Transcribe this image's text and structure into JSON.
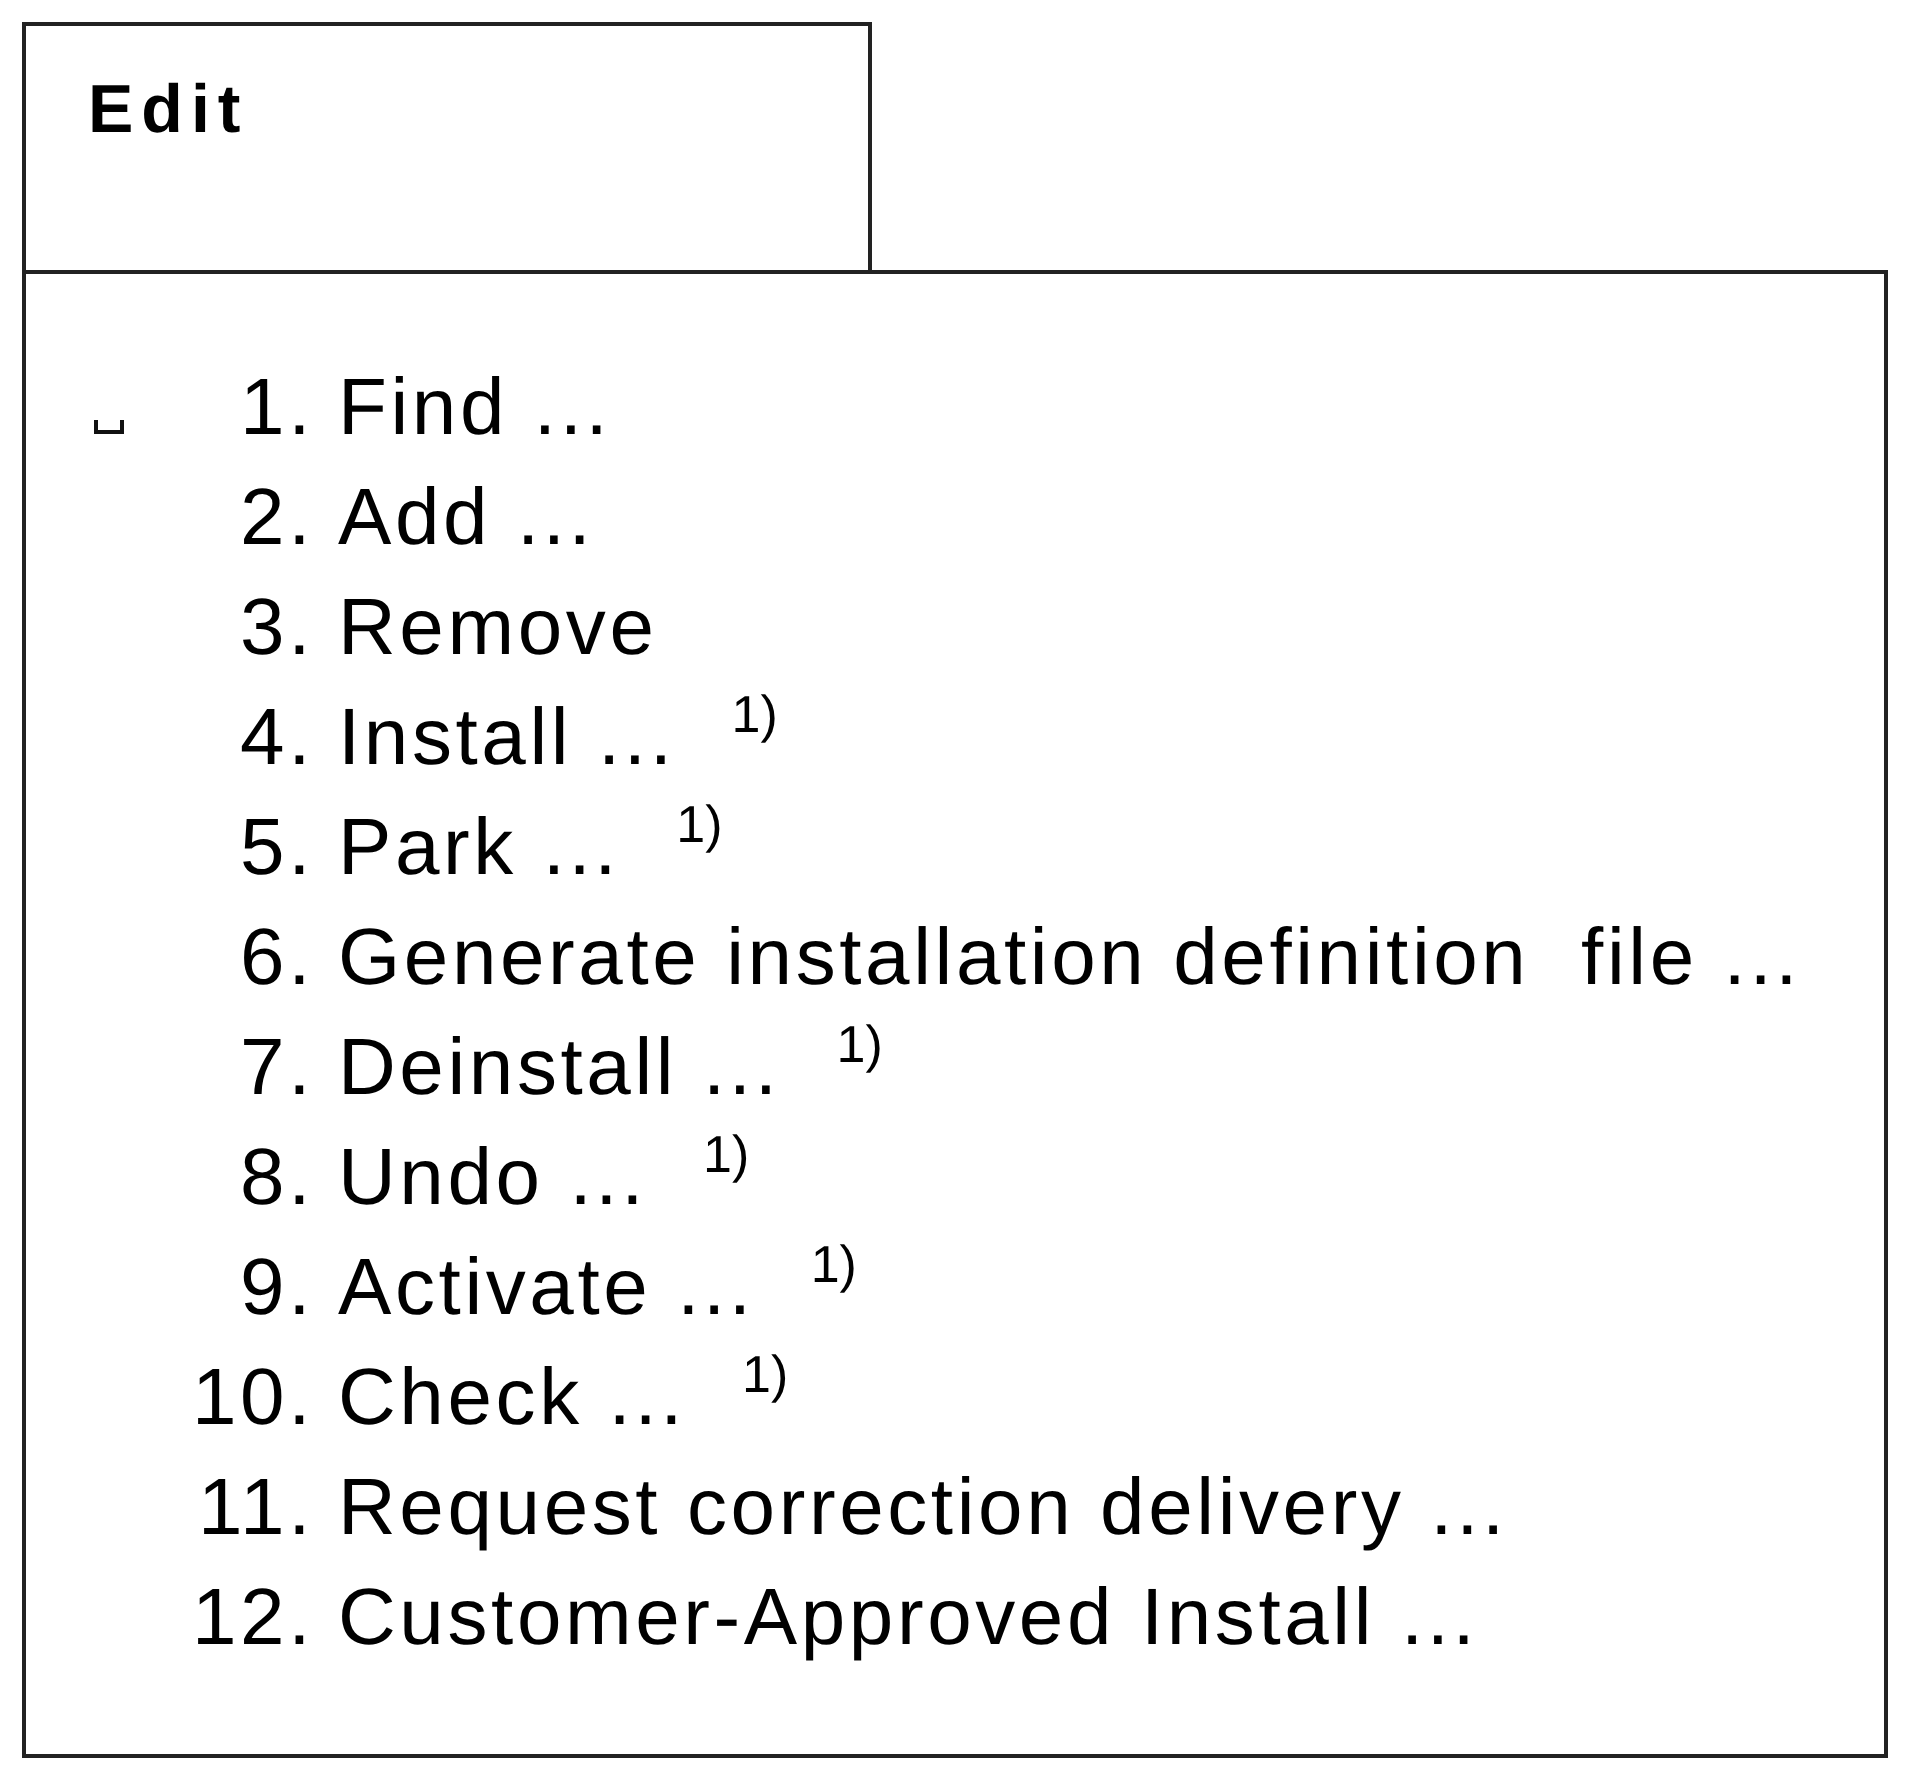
{
  "tab": {
    "title": "Edit"
  },
  "menu": {
    "items": [
      {
        "number": "1.",
        "label": "Find ...",
        "selected": true
      },
      {
        "number": "2.",
        "label": "Add ...",
        "selected": false
      },
      {
        "number": "3.",
        "label": "Remove",
        "selected": false
      },
      {
        "number": "4.",
        "label": "Install ...",
        "note": "1)",
        "selected": false
      },
      {
        "number": "5.",
        "label": "Park ...",
        "note": "1)",
        "selected": false
      },
      {
        "number": "6.",
        "label": "Generate installation definition  file ...",
        "selected": false
      },
      {
        "number": "7.",
        "label": "Deinstall ...",
        "note": "1)",
        "selected": false
      },
      {
        "number": "8.",
        "label": "Undo ...",
        "note": "1)",
        "selected": false
      },
      {
        "number": "9.",
        "label": "Activate ...",
        "note": "1)",
        "selected": false
      },
      {
        "number": "10.",
        "label": "Check ...",
        "note": "1)",
        "selected": false
      },
      {
        "number": "11.",
        "label": "Request correction delivery ...",
        "selected": false
      },
      {
        "number": "12.",
        "label": "Customer-Approved Install ...",
        "selected": false
      }
    ]
  }
}
